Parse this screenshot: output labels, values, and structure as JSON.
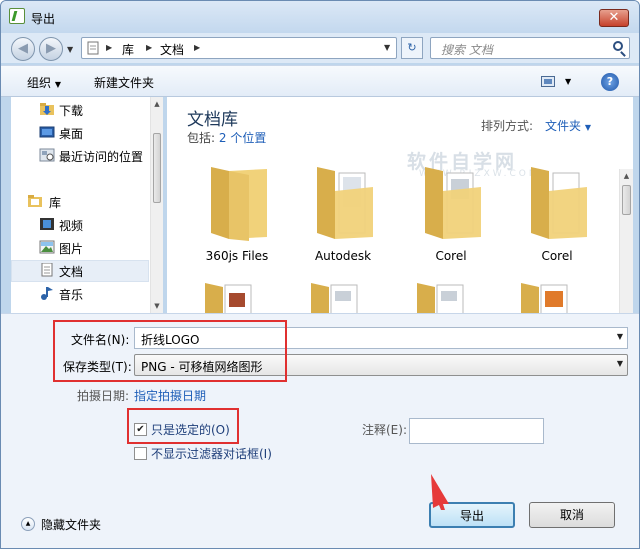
{
  "window": {
    "title": "导出",
    "close_label": "✕"
  },
  "nav": {
    "path": [
      "库",
      "文档"
    ],
    "search_placeholder": "搜索 文档"
  },
  "toolbar": {
    "organize": "组织",
    "new_folder": "新建文件夹"
  },
  "sidebar": {
    "items": [
      {
        "label": "下载",
        "icon": "download-folder-icon"
      },
      {
        "label": "桌面",
        "icon": "desktop-icon"
      },
      {
        "label": "最近访问的位置",
        "icon": "recent-places-icon"
      },
      {
        "label": "库",
        "icon": "library-icon"
      },
      {
        "label": "视频",
        "icon": "video-icon"
      },
      {
        "label": "图片",
        "icon": "pictures-icon"
      },
      {
        "label": "文档",
        "icon": "documents-icon",
        "selected": true
      },
      {
        "label": "音乐",
        "icon": "music-icon"
      }
    ]
  },
  "library": {
    "title": "文档库",
    "includes_label": "包括:",
    "includes_link": "2 个位置",
    "sort_label": "排列方式:",
    "sort_value": "文件夹",
    "watermark": "软件自学网",
    "watermark_url": "WWW.RJZXW.COM",
    "folders": [
      "360js Files",
      "Autodesk",
      "Corel",
      "Corel"
    ]
  },
  "form": {
    "filename_label": "文件名(N):",
    "filename_value": "折线LOGO",
    "filetype_label": "保存类型(T):",
    "filetype_value": "PNG - 可移植网络图形",
    "date_label": "拍摄日期:",
    "date_link": "指定拍摄日期",
    "only_selected_label": "只是选定的(O)",
    "only_selected_checked": true,
    "hide_filter_label": "不显示过滤器对话框(I)",
    "hide_filter_checked": false,
    "notes_label": "注释(E):",
    "notes_value": "",
    "hide_folders_label": "隐藏文件夹",
    "export_button": "导出",
    "cancel_button": "取消"
  },
  "colors": {
    "accent": "#1f5fb8",
    "highlight_box": "#e03030",
    "folder": "#f1d27a"
  }
}
